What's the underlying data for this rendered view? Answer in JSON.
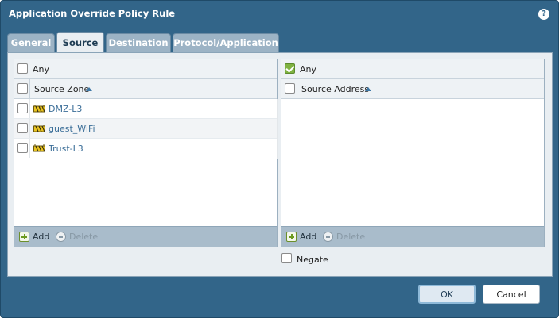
{
  "dialog": {
    "title": "Application Override Policy Rule",
    "help_glyph": "?"
  },
  "tabs": [
    {
      "label": "General",
      "active": false
    },
    {
      "label": "Source",
      "active": true
    },
    {
      "label": "Destination",
      "active": false
    },
    {
      "label": "Protocol/Application",
      "active": false
    }
  ],
  "source_zone_panel": {
    "any_label": "Any",
    "any_checked": false,
    "column_header": "Source Zone",
    "rows": [
      {
        "name": "DMZ-L3",
        "checked": false
      },
      {
        "name": "guest_WiFi",
        "checked": false
      },
      {
        "name": "Trust-L3",
        "checked": false
      }
    ],
    "add_label": "Add",
    "delete_label": "Delete"
  },
  "source_address_panel": {
    "any_label": "Any",
    "any_checked": true,
    "column_header": "Source Address",
    "rows": [],
    "add_label": "Add",
    "delete_label": "Delete"
  },
  "negate": {
    "label": "Negate",
    "checked": false
  },
  "buttons": {
    "ok_label": "OK",
    "cancel_label": "Cancel"
  },
  "colors": {
    "dialog_bg": "#326589",
    "tab_inactive": "#9cb3c5",
    "content_bg": "#e9eef2",
    "link_text": "#3b6e98",
    "check_green": "#7fb241",
    "zone_icon": "#e8c320"
  }
}
